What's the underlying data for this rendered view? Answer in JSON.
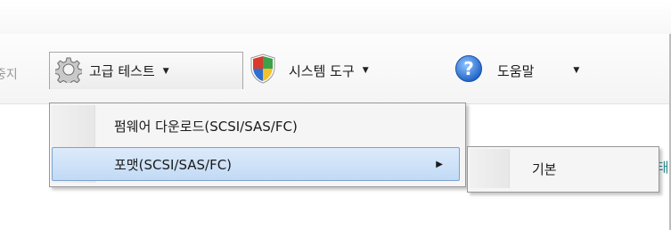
{
  "toolbar": {
    "partial_left_label": "중지",
    "advanced_test_label": "고급 테스트",
    "system_tools_label": "시스템 도구",
    "help_label": "도움말",
    "dropdown_arrow": "▼"
  },
  "menu": {
    "items": [
      {
        "label": "펌웨어 다운로드(SCSI/SAS/FC)"
      },
      {
        "label": "포맷(SCSI/SAS/FC)",
        "submenu_arrow": "▶"
      }
    ]
  },
  "submenu": {
    "items": [
      {
        "label": "기본"
      }
    ]
  },
  "content": {
    "partial_right_label": "상태"
  },
  "colors": {
    "highlight": "#c8def7",
    "highlight_border": "#7da2ce",
    "shield_red": "#d93a2b",
    "shield_green": "#3aa24a",
    "shield_blue": "#2d6fcf",
    "shield_yellow": "#f2c12e",
    "help_blue": "#2e7fe0"
  }
}
